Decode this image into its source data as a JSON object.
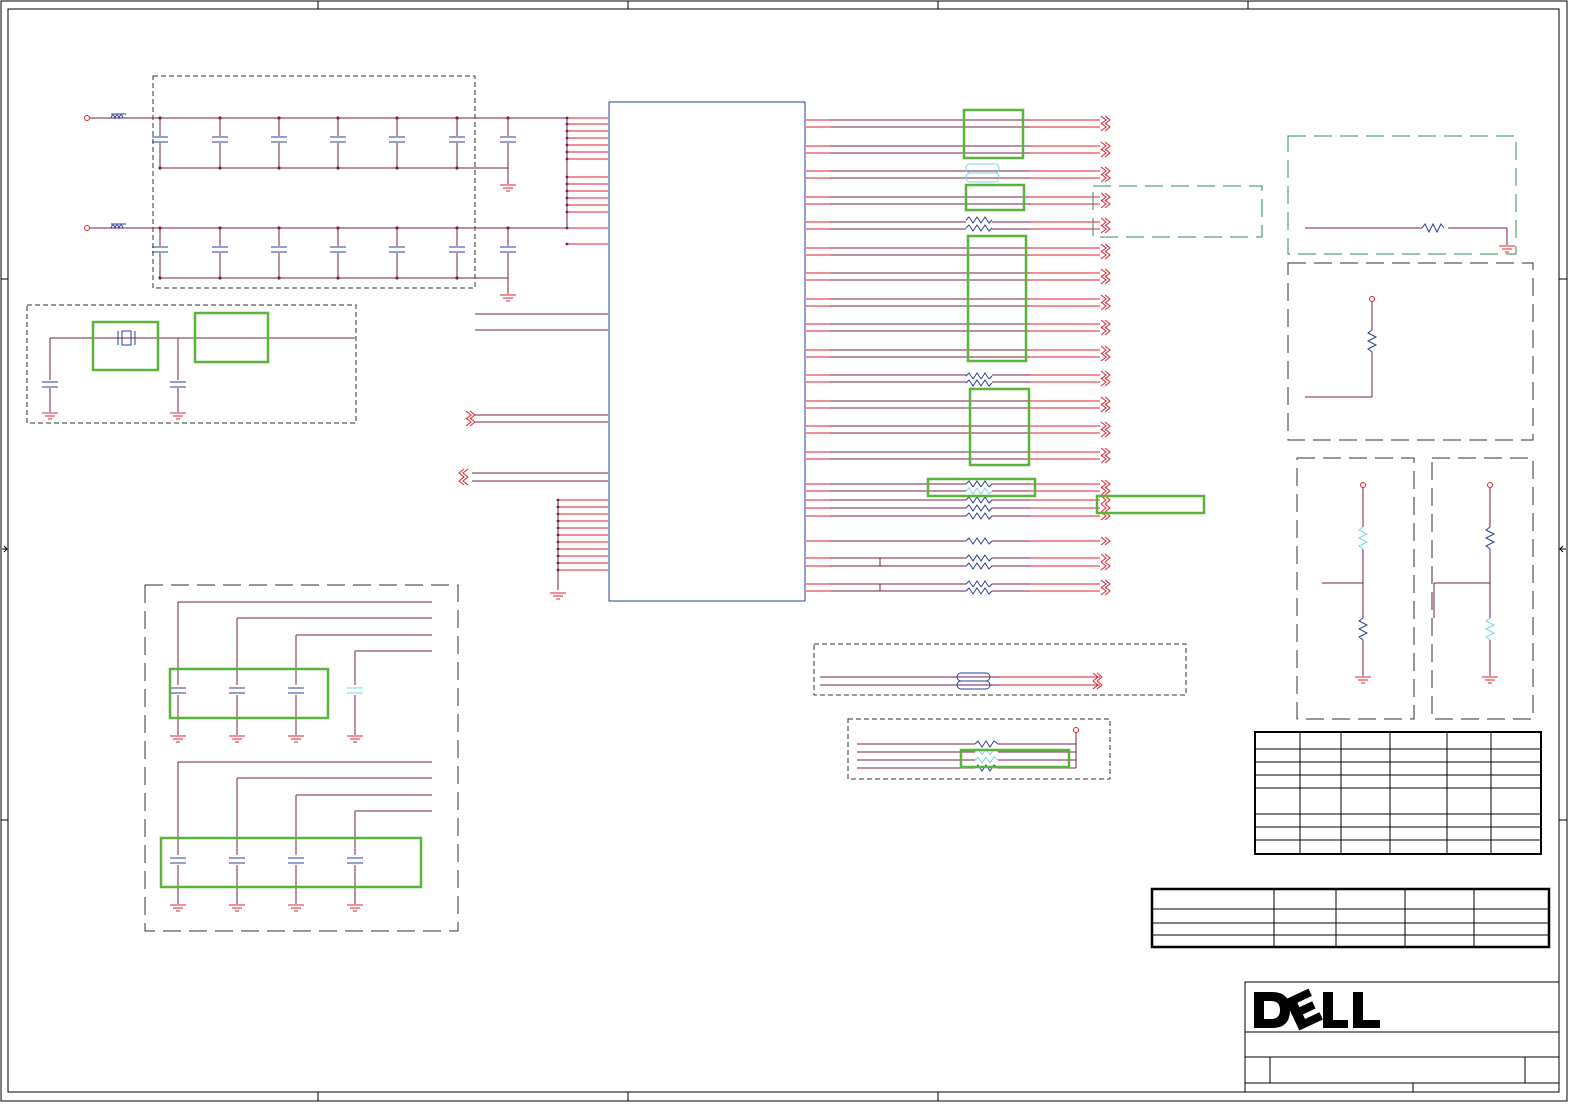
{
  "brand": {
    "logo_text": "DELL",
    "logo_color": "#000000"
  },
  "colors": {
    "net_red": "#e0202c",
    "net_purple": "#7a1f4a",
    "component_blue": "#2b3f9a",
    "highlight_green": "#5ab33a",
    "region_dashed": "#333333",
    "region_green_dashed": "#2e8b57",
    "ground_red": "#e0202c",
    "light_cyan": "#7fd3e0",
    "frame": "#000000"
  },
  "icons": {
    "ground": "ground-symbol-icon",
    "capacitor": "capacitor-icon",
    "resistor": "resistor-icon",
    "crystal": "crystal-icon",
    "offpage_connector": "offpage-arrow-icon",
    "power_pin": "power-pin-icon"
  },
  "title_block": {
    "size_cell": "",
    "doc_number": "",
    "rev": "",
    "sheet": ""
  }
}
